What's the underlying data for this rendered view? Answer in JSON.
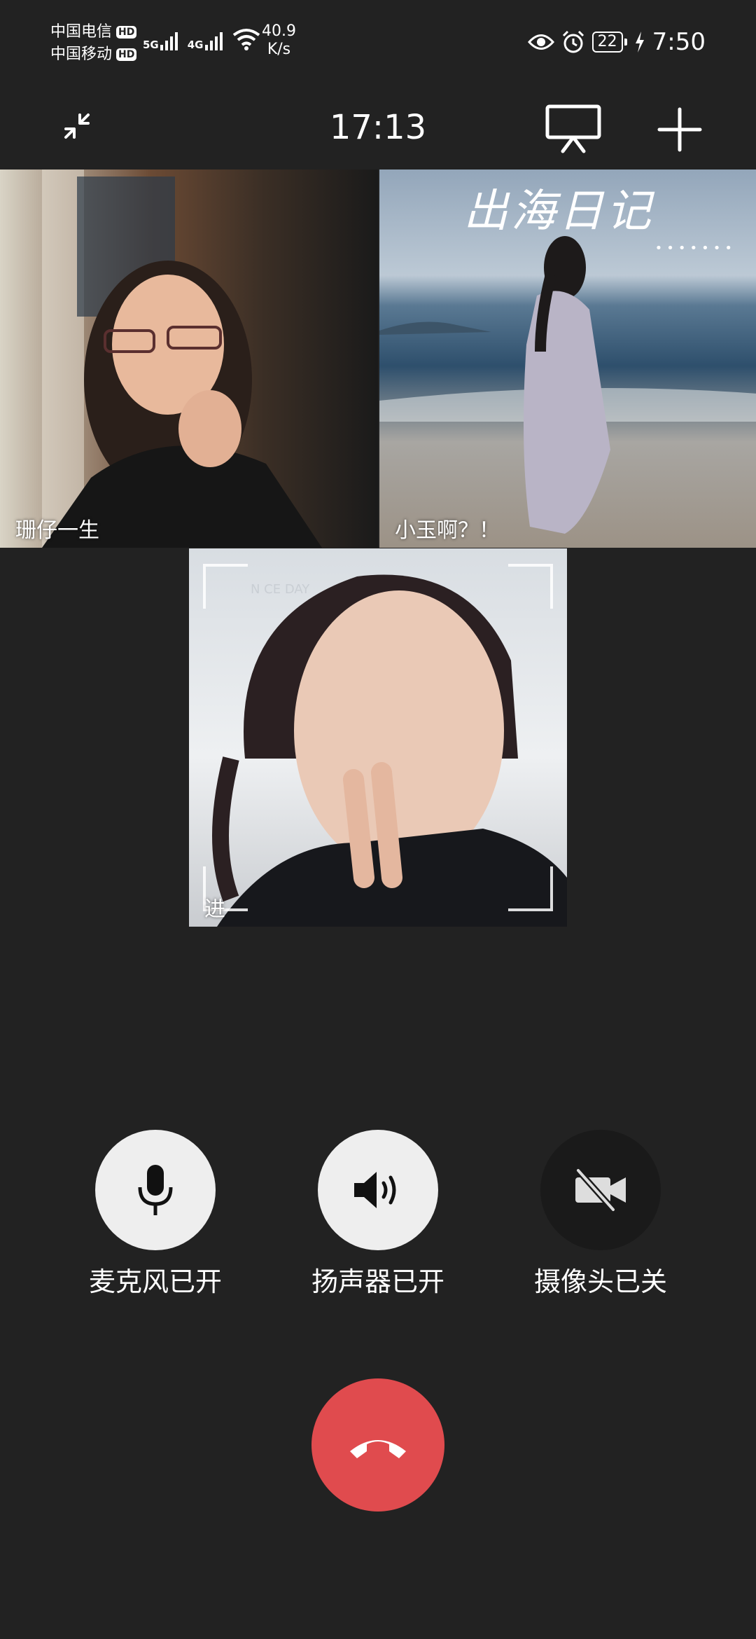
{
  "status_bar": {
    "carrier1": "中国电信",
    "carrier2": "中国移动",
    "hd_badge": "HD",
    "net1": "5G",
    "net2": "4G",
    "speed_value": "40.9",
    "speed_unit": "K/s",
    "battery": "22",
    "time": "7:50"
  },
  "header": {
    "call_duration": "17:13"
  },
  "participants": [
    {
      "name": "珊仔一生"
    },
    {
      "name": "小玉啊？！",
      "overlay_title": "出海日记",
      "overlay_dots": "•••••••"
    },
    {
      "name": "进",
      "overlay_text": "N  CE DAY"
    }
  ],
  "controls": {
    "mic_label": "麦克风已开",
    "speaker_label": "扬声器已开",
    "camera_label": "摄像头已关"
  },
  "colors": {
    "background": "#222222",
    "hangup": "#e04b4e",
    "active_button": "#eeeeee",
    "inactive_button": "#1a1a1a"
  }
}
